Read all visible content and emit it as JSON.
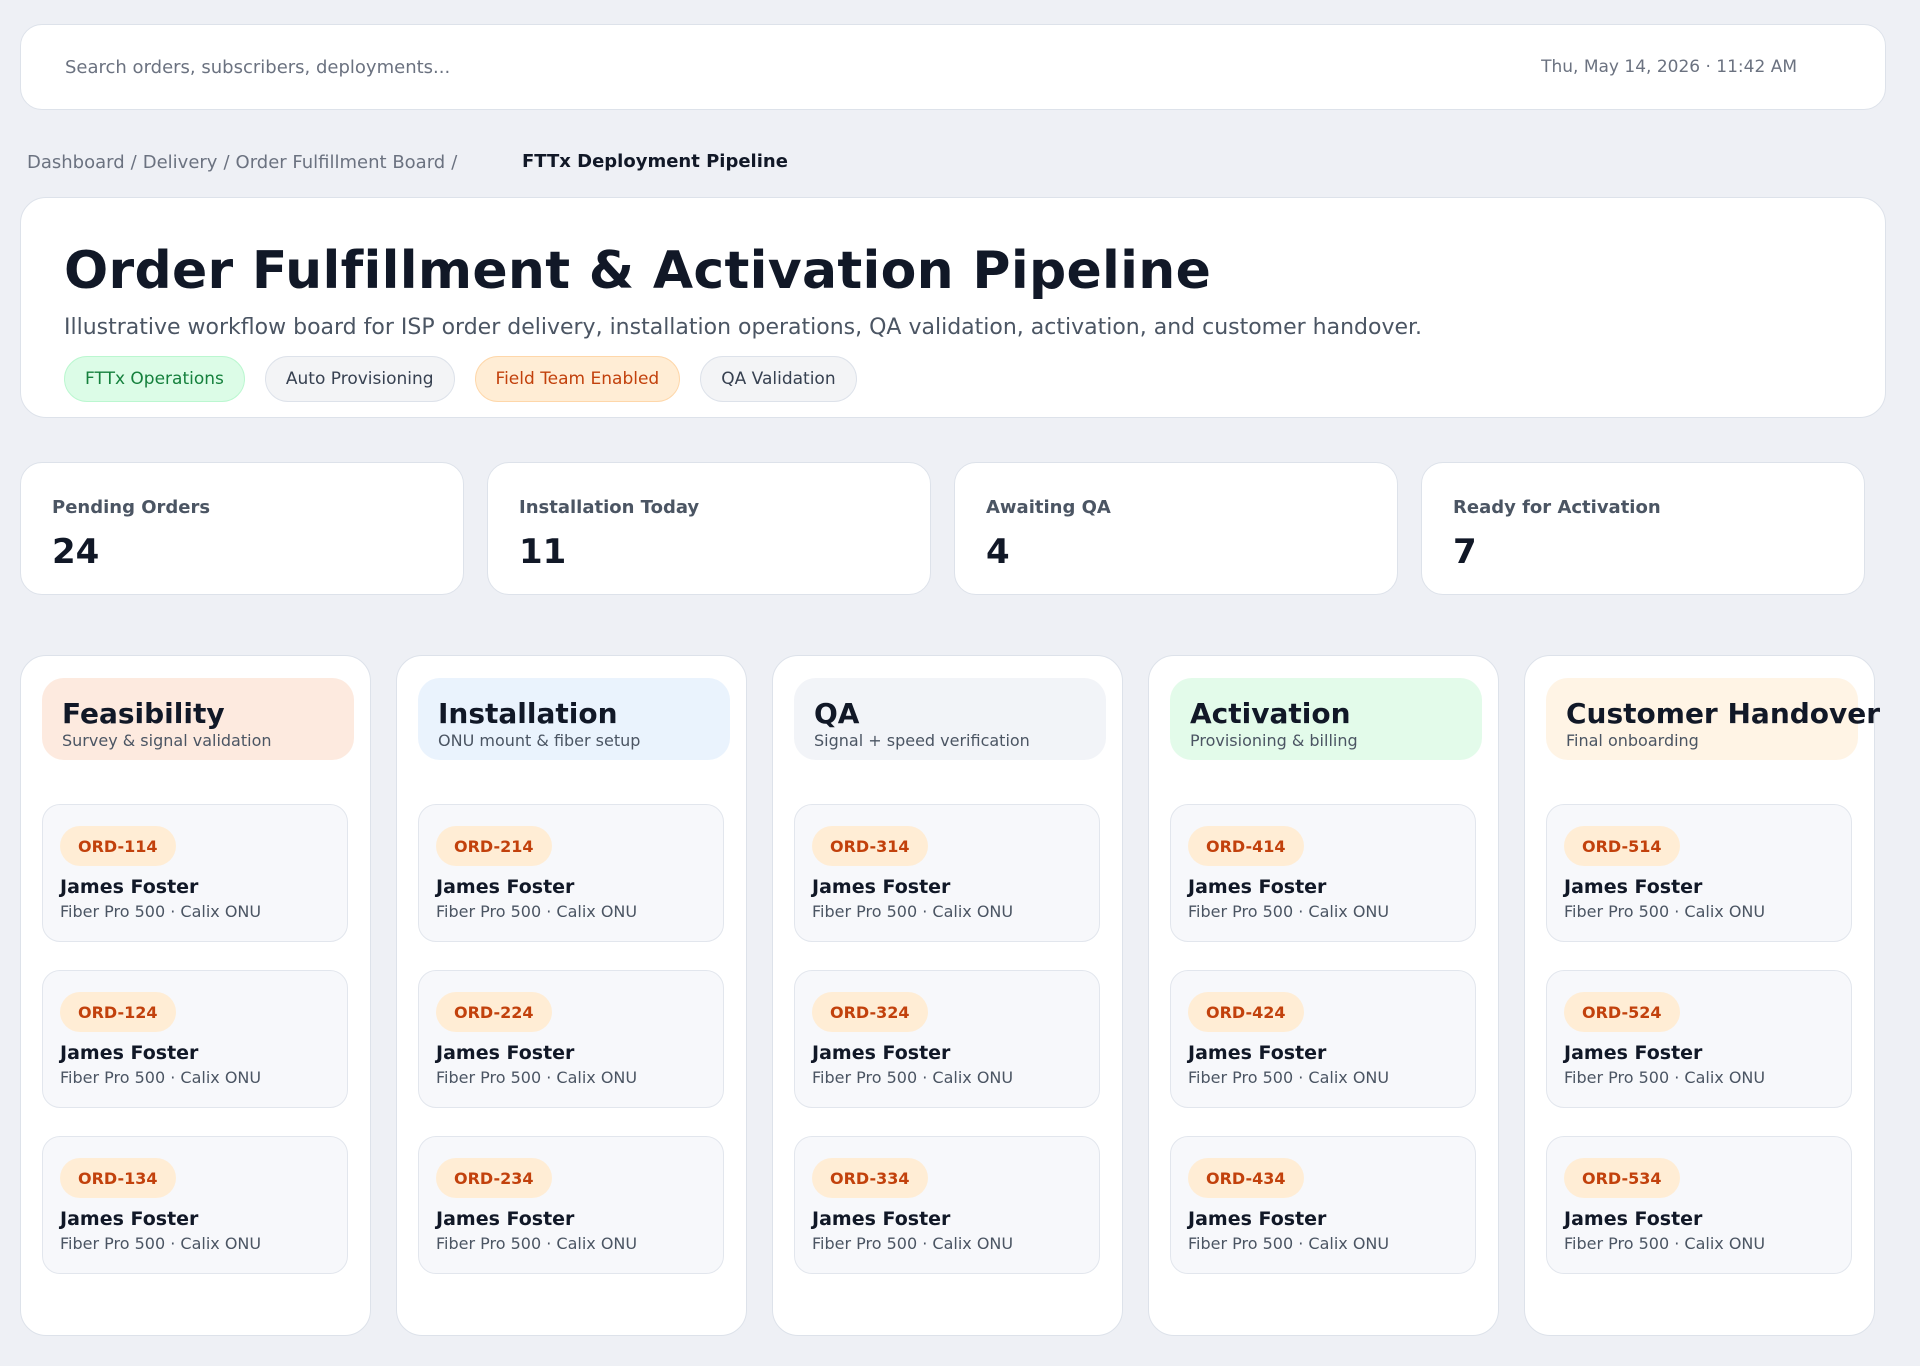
{
  "search": {
    "placeholder": "Search orders, subscribers, deployments..."
  },
  "header": {
    "datetime": "Thu, May 14, 2026 · 11:42 AM"
  },
  "breadcrumb": {
    "items": [
      "Dashboard",
      "Delivery",
      "Order Fulfillment Board"
    ],
    "current": "FTTx Deployment Pipeline"
  },
  "hero": {
    "title": "Order Fulfillment & Activation Pipeline",
    "subtitle": "Illustrative workflow board for ISP order delivery, installation operations, QA validation, activation, and customer handover.",
    "tags": [
      {
        "label": "FTTx Operations",
        "color": "#15803d"
      },
      {
        "label": "Auto Provisioning",
        "color": "#374151"
      },
      {
        "label": "Field Team Enabled",
        "color": "#c2410c"
      },
      {
        "label": "QA Validation",
        "color": "#374151"
      }
    ]
  },
  "stats": [
    {
      "label": "Pending Orders",
      "value": "24"
    },
    {
      "label": "Installation Today",
      "value": "11"
    },
    {
      "label": "Awaiting QA",
      "value": "4"
    },
    {
      "label": "Ready for Activation",
      "value": "7"
    }
  ],
  "columns": [
    {
      "title": "Feasibility",
      "subtitle": "Survey & signal validation",
      "header_color": "#fdeadf",
      "cards": [
        {
          "id": "ORD-114",
          "name": "James Foster",
          "plan": "Fiber Pro 500 · Calix ONU"
        },
        {
          "id": "ORD-124",
          "name": "James Foster",
          "plan": "Fiber Pro 500 · Calix ONU"
        },
        {
          "id": "ORD-134",
          "name": "James Foster",
          "plan": "Fiber Pro 500 · Calix ONU"
        }
      ]
    },
    {
      "title": "Installation",
      "subtitle": "ONU mount & fiber setup",
      "header_color": "#eaf3fd",
      "cards": [
        {
          "id": "ORD-214",
          "name": "James Foster",
          "plan": "Fiber Pro 500 · Calix ONU"
        },
        {
          "id": "ORD-224",
          "name": "James Foster",
          "plan": "Fiber Pro 500 · Calix ONU"
        },
        {
          "id": "ORD-234",
          "name": "James Foster",
          "plan": "Fiber Pro 500 · Calix ONU"
        }
      ]
    },
    {
      "title": "QA",
      "subtitle": "Signal + speed verification",
      "header_color": "#f2f4f8",
      "cards": [
        {
          "id": "ORD-314",
          "name": "James Foster",
          "plan": "Fiber Pro 500 · Calix ONU"
        },
        {
          "id": "ORD-324",
          "name": "James Foster",
          "plan": "Fiber Pro 500 · Calix ONU"
        },
        {
          "id": "ORD-334",
          "name": "James Foster",
          "plan": "Fiber Pro 500 · Calix ONU"
        }
      ]
    },
    {
      "title": "Activation",
      "subtitle": "Provisioning & billing",
      "header_color": "#e3fbea",
      "cards": [
        {
          "id": "ORD-414",
          "name": "James Foster",
          "plan": "Fiber Pro 500 · Calix ONU"
        },
        {
          "id": "ORD-424",
          "name": "James Foster",
          "plan": "Fiber Pro 500 · Calix ONU"
        },
        {
          "id": "ORD-434",
          "name": "James Foster",
          "plan": "Fiber Pro 500 · Calix ONU"
        }
      ]
    },
    {
      "title": "Customer Handover",
      "subtitle": "Final onboarding",
      "header_color": "#fff4e5",
      "cards": [
        {
          "id": "ORD-514",
          "name": "James Foster",
          "plan": "Fiber Pro 500 · Calix ONU"
        },
        {
          "id": "ORD-524",
          "name": "James Foster",
          "plan": "Fiber Pro 500 · Calix ONU"
        },
        {
          "id": "ORD-534",
          "name": "James Foster",
          "plan": "Fiber Pro 500 · Calix ONU"
        }
      ]
    }
  ]
}
